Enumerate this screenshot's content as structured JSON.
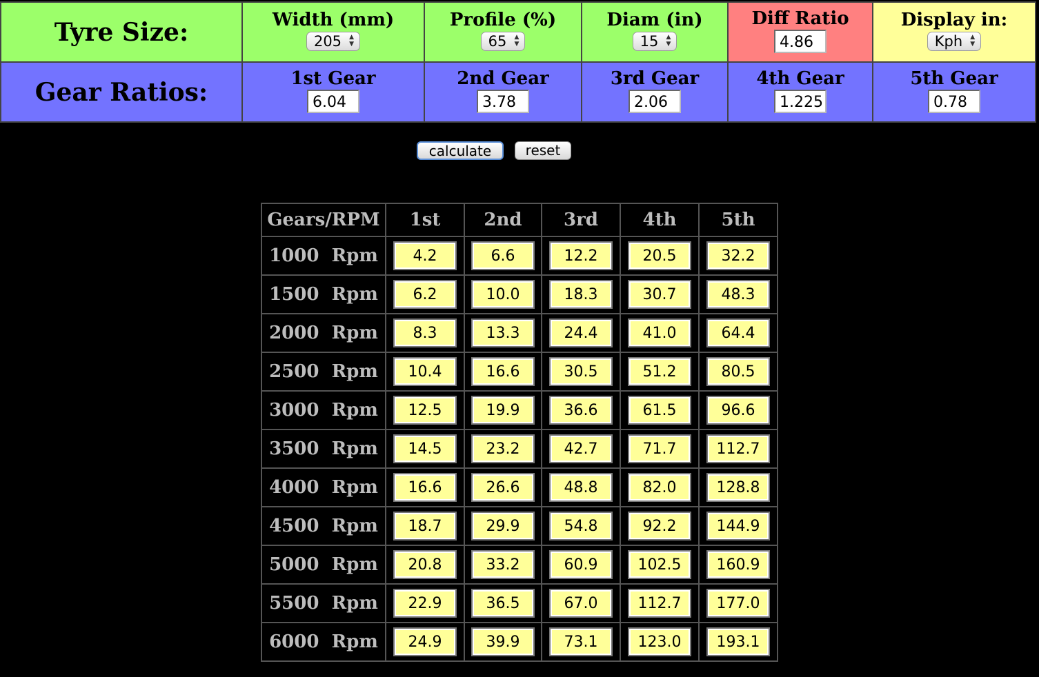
{
  "tyre_size": {
    "title": "Tyre Size:",
    "width": {
      "label": "Width (mm)",
      "value": "205"
    },
    "profile": {
      "label": "Profile (%)",
      "value": "65"
    },
    "diam": {
      "label": "Diam (in)",
      "value": "15"
    },
    "diff_ratio": {
      "label": "Diff Ratio",
      "value": "4.86"
    },
    "display_in": {
      "label": "Display in:",
      "value": "Kph"
    }
  },
  "gear_ratios": {
    "title": "Gear Ratios:",
    "gears": [
      {
        "label": "1st Gear",
        "value": "6.04"
      },
      {
        "label": "2nd Gear",
        "value": "3.78"
      },
      {
        "label": "3rd Gear",
        "value": "2.06"
      },
      {
        "label": "4th Gear",
        "value": "1.225"
      },
      {
        "label": "5th Gear",
        "value": "0.78"
      }
    ]
  },
  "buttons": {
    "calculate": "calculate",
    "reset": "reset"
  },
  "colors": {
    "tyre_row": "#9cff6a",
    "gear_row": "#7373ff",
    "diff_cell": "#ff8080",
    "display_cell": "#ffff99",
    "result_cell": "#ffff99"
  },
  "results": {
    "header": "Gears/RPM",
    "columns": [
      "1st",
      "2nd",
      "3rd",
      "4th",
      "5th"
    ],
    "rows": [
      {
        "rpm": "1000",
        "unit": "Rpm",
        "values": [
          "4.2",
          "6.6",
          "12.2",
          "20.5",
          "32.2"
        ]
      },
      {
        "rpm": "1500",
        "unit": "Rpm",
        "values": [
          "6.2",
          "10.0",
          "18.3",
          "30.7",
          "48.3"
        ]
      },
      {
        "rpm": "2000",
        "unit": "Rpm",
        "values": [
          "8.3",
          "13.3",
          "24.4",
          "41.0",
          "64.4"
        ]
      },
      {
        "rpm": "2500",
        "unit": "Rpm",
        "values": [
          "10.4",
          "16.6",
          "30.5",
          "51.2",
          "80.5"
        ]
      },
      {
        "rpm": "3000",
        "unit": "Rpm",
        "values": [
          "12.5",
          "19.9",
          "36.6",
          "61.5",
          "96.6"
        ]
      },
      {
        "rpm": "3500",
        "unit": "Rpm",
        "values": [
          "14.5",
          "23.2",
          "42.7",
          "71.7",
          "112.7"
        ]
      },
      {
        "rpm": "4000",
        "unit": "Rpm",
        "values": [
          "16.6",
          "26.6",
          "48.8",
          "82.0",
          "128.8"
        ]
      },
      {
        "rpm": "4500",
        "unit": "Rpm",
        "values": [
          "18.7",
          "29.9",
          "54.8",
          "92.2",
          "144.9"
        ]
      },
      {
        "rpm": "5000",
        "unit": "Rpm",
        "values": [
          "20.8",
          "33.2",
          "60.9",
          "102.5",
          "160.9"
        ]
      },
      {
        "rpm": "5500",
        "unit": "Rpm",
        "values": [
          "22.9",
          "36.5",
          "67.0",
          "112.7",
          "177.0"
        ]
      },
      {
        "rpm": "6000",
        "unit": "Rpm",
        "values": [
          "24.9",
          "39.9",
          "73.1",
          "123.0",
          "193.1"
        ]
      }
    ]
  }
}
